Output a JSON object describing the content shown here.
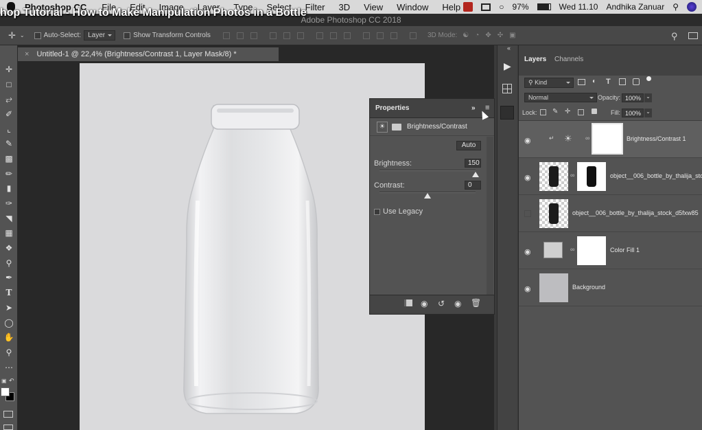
{
  "menubar": {
    "app": "Photoshop CC",
    "items": [
      "File",
      "Edit",
      "Image",
      "Layer",
      "Type",
      "Select",
      "Filter",
      "3D",
      "View",
      "Window",
      "Help"
    ],
    "battery": "97%",
    "datetime": "Wed 11.10",
    "user": "Andhika Zanuar"
  },
  "video_title": "hop Tutorial - How to Make Manipulation Photos in a Bottle",
  "window_title": "Adobe Photoshop CC 2018",
  "options": {
    "auto_select_label": "Auto-Select:",
    "auto_select_value": "Layer",
    "show_transform_label": "Show Transform Controls",
    "mode_3d_label": "3D Mode:"
  },
  "document": {
    "tab_title": "Untitled-1 @ 22,4% (Brightness/Contrast 1, Layer Mask/8) *"
  },
  "properties": {
    "title": "Properties",
    "adjustment": "Brightness/Contrast",
    "auto_label": "Auto",
    "brightness_label": "Brightness:",
    "brightness_value": "150",
    "brightness_fraction": 1.0,
    "contrast_label": "Contrast:",
    "contrast_value": "0",
    "contrast_fraction": 0.5,
    "legacy_label": "Use Legacy"
  },
  "layers_panel": {
    "tabs": [
      "Layers",
      "Channels"
    ],
    "filter_kind": "Kind",
    "blend_mode": "Normal",
    "opacity_label": "Opacity:",
    "opacity_value": "100%",
    "lock_label": "Lock:",
    "fill_label": "Fill:",
    "fill_value": "100%",
    "layers": [
      {
        "name": "Brightness/Contrast 1",
        "visible": true
      },
      {
        "name": "object__006_bottle_by_thalija_stoc",
        "visible": true
      },
      {
        "name": "object__006_bottle_by_thalija_stock_d5fxw85",
        "visible": false
      },
      {
        "name": "Color Fill 1",
        "visible": true
      },
      {
        "name": "Background",
        "visible": true
      }
    ]
  },
  "colors": {
    "ui_dark": "#282828",
    "panel": "#535353",
    "canvas": "#dadadc",
    "selected_layer": "#5f5f5f"
  }
}
